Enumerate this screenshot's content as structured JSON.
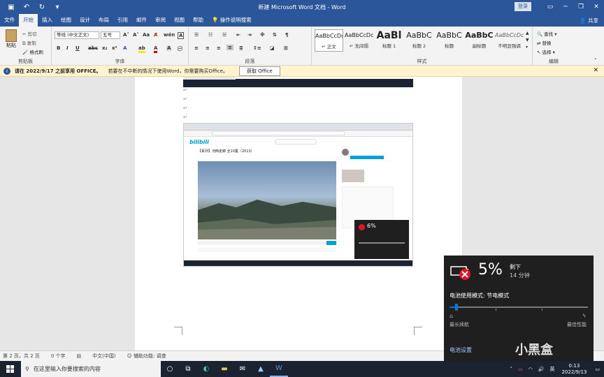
{
  "window": {
    "title": "新建 Microsoft Word 文档 - Word",
    "login_label": "登录",
    "controls": [
      "ribbon-display-icon",
      "minimize-icon",
      "restore-icon",
      "close-icon"
    ]
  },
  "tabs": [
    "文件",
    "开始",
    "插入",
    "绘图",
    "设计",
    "布局",
    "引用",
    "邮件",
    "审阅",
    "视图",
    "帮助"
  ],
  "active_tab": "开始",
  "tell_me": "操作说明搜索",
  "share_label": "共享",
  "ribbon": {
    "clipboard": {
      "paste": "粘贴",
      "cut": "剪切",
      "copy": "复制",
      "format_painter": "格式刷",
      "label": "剪贴板"
    },
    "font": {
      "font_name": "等线 (中文正文)",
      "font_size": "五号",
      "label": "字体"
    },
    "paragraph": {
      "label": "段落"
    },
    "styles": {
      "label": "样式",
      "items": [
        {
          "sample": "AaBbCcDc",
          "name": "正文"
        },
        {
          "sample": "AaBbCcDc",
          "name": "无间隔"
        },
        {
          "sample": "AaBl",
          "name": "标题 1"
        },
        {
          "sample": "AaBbC",
          "name": "标题 2"
        },
        {
          "sample": "AaBbC",
          "name": "标题"
        },
        {
          "sample": "AaBbC",
          "name": "副标题"
        },
        {
          "sample": "AaBbCcDc",
          "name": "不明显强调"
        }
      ]
    },
    "editing": {
      "find": "查找",
      "replace": "替换",
      "select": "选择",
      "label": "编辑"
    }
  },
  "infobar": {
    "message": "请在 2022/9/17 之前享用 OFFICE。",
    "sub": "若要在不中断的情况下使用Word，你需要购买Office。",
    "button": "获取 Office"
  },
  "statusbar": {
    "page": "第 2 页，共 2 页",
    "words": "0 个字",
    "language": "中文(中国)",
    "accessibility": "辅助功能: 调查"
  },
  "embedded": {
    "video_title": "【系列】河西走廊 全10集（2013）",
    "popup_percent": "6%"
  },
  "battery": {
    "percent": "5%",
    "remaining_label": "剩下",
    "remaining_time": "14 分钟",
    "mode_label": "电池使用模式: 节电模式",
    "left_label": "最长续航",
    "right_label": "最佳性能",
    "settings": "电池设置",
    "slider_level": 0.05
  },
  "taskbar": {
    "search_placeholder": "在这里输入你要搜索的内容",
    "ime": "英",
    "time": "0:13",
    "date": "2022/9/13"
  },
  "watermark": "小黑盒"
}
